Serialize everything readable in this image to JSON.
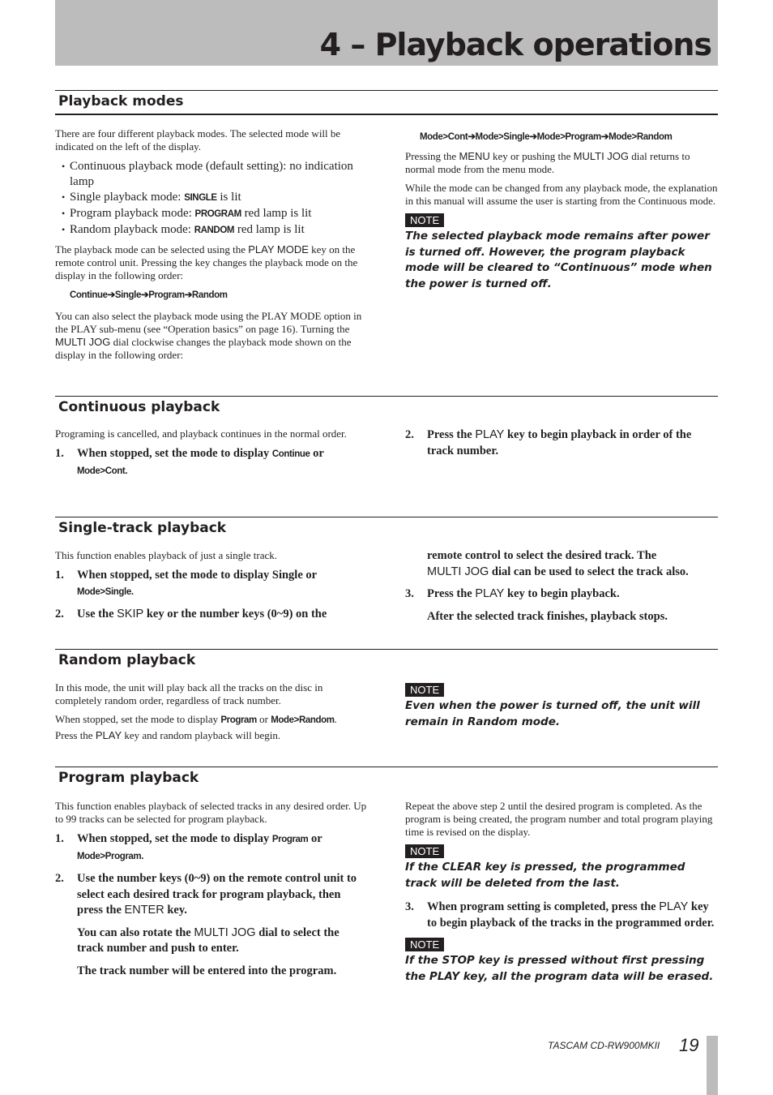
{
  "chapter_title": "4 – Playback operations",
  "sections": {
    "modes": {
      "heading": "Playback modes",
      "intro": "There are four different playback modes. The selected  mode will be indicated on the left of the display.",
      "bullets": [
        {
          "text": "Continuous playback mode (default setting): no indication lamp"
        },
        {
          "prefix": "Single playback mode: ",
          "lamp": "SINGLE",
          "suffix": " is lit"
        },
        {
          "prefix": "Program playback mode: ",
          "lamp": "PROGRAM",
          "suffix": " red lamp is lit"
        },
        {
          "prefix": "Random playback mode: ",
          "lamp": "RANDOM",
          "suffix": " red lamp is lit"
        }
      ],
      "para2_a": "The playback mode can be selected using the ",
      "para2_key": "PLAY MODE",
      "para2_b": " key on the remote control unit. Pressing the key changes the playback mode on the display in the following order:",
      "seq1": "Continue➔Single➔Program➔Random",
      "para3_a": "You can also select the playback mode using the PLAY MODE option in the PLAY sub-menu (see “Operation basics” on page 16). Turning the ",
      "para3_key": "MULTI JOG",
      "para3_b": " dial clockwise changes the playback mode shown on the display in the following order:",
      "seq2": "Mode>Cont➔Mode>Single➔Mode>Program➔Mode>Random",
      "para4_a": "Pressing the ",
      "para4_key1": "MENU",
      "para4_b": " key or pushing the ",
      "para4_key2": "MULTI JOG",
      "para4_c": " dial returns to normal mode from the menu mode.",
      "para5": "While the mode can be changed from any playback mode, the explanation in this manual will assume the user is starting from the Continuous mode.",
      "note_label": "NOTE",
      "note": "The selected playback mode remains after power is turned off. However, the program playback mode will be cleared to “Continuous” mode when the power is turned off."
    },
    "continuous": {
      "heading": "Continuous playback",
      "intro": "Programing is cancelled, and playback continues in the normal order.",
      "step1_num": "1.",
      "step1_a": "When stopped, set the mode to display ",
      "step1_d1": "Continue",
      "step1_b": " or ",
      "step1_d2": "Mode>Cont.",
      "step2_num": "2.",
      "step2_a": "Press the ",
      "step2_key": "PLAY",
      "step2_b": " key to begin playback in order of the track number."
    },
    "single": {
      "heading": "Single-track playback",
      "intro": "This function enables playback of just a single track.",
      "step1_num": "1.",
      "step1_a": "When stopped, set the mode to display Single or ",
      "step1_d": "Mode>Single.",
      "step2_num": "2.",
      "step2_a": "Use the ",
      "step2_key": "SKIP",
      "step2_b": " key or the number keys (0~9) on the",
      "step2_cont": "remote control to select the desired track. The",
      "step2_key2": "MULTI JOG",
      "step2_cont2": " dial can be used to select the track also.",
      "step3_num": "3.",
      "step3_a": "Press the ",
      "step3_key": "PLAY",
      "step3_b": " key to begin playback.",
      "step3_sub": "After the selected track finishes, playback stops."
    },
    "random": {
      "heading": "Random playback",
      "intro": "In this mode, the unit will play back all the tracks on the disc in completely random order, regardless of track number.",
      "para2_a": "When stopped, set the mode to display ",
      "para2_d1": "Program",
      "para2_b": " or ",
      "para2_d2": "Mode>Random",
      "para2_c": ".",
      "para3_a": "Press the ",
      "para3_key": "PLAY",
      "para3_b": " key and random playback will begin.",
      "note_label": "NOTE",
      "note": "Even when the power is turned off, the unit will remain in Random mode."
    },
    "program": {
      "heading": "Program playback",
      "intro": "This function enables playback of selected tracks in any desired order. Up to 99 tracks can be selected for program playback.",
      "step1_num": "1.",
      "step1_a": "When stopped, set the mode to display ",
      "step1_d1": "Program",
      "step1_b": " or ",
      "step1_d2": "Mode>Program.",
      "step2_num": "2.",
      "step2_a": "Use the number keys (0~9) on the remote control unit to select each desired track for program playback, then press the ",
      "step2_key": "ENTER",
      "step2_b": " key.",
      "step2_sub1_a": "You can also rotate the ",
      "step2_sub1_key": "MULTI JOG",
      "step2_sub1_b": " dial to select the track number and push to enter.",
      "step2_sub2": "The track number will be entered into the program.",
      "right_intro": "Repeat the above step 2 until the desired program is completed. As the program is being created, the program number and total program playing time is revised on the display.",
      "note1_label": "NOTE",
      "note1": "If the CLEAR key is pressed, the programmed track will be deleted from the last.",
      "step3_num": "3.",
      "step3_a": "When program setting is completed, press the ",
      "step3_key": "PLAY",
      "step3_b": " key to begin playback of the tracks in the programmed order.",
      "note2_label": "NOTE",
      "note2": "If the STOP key is pressed without first pressing the PLAY key, all the program data will be erased."
    }
  },
  "footer": {
    "product": "TASCAM  CD-RW900MKII",
    "page_number": "19"
  }
}
